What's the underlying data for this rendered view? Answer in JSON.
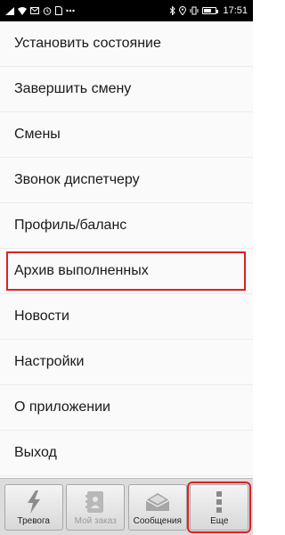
{
  "status_bar": {
    "time": "17:51",
    "battery_level": 0.7,
    "icons_left": [
      "signal-icon",
      "wifi-icon",
      "email-icon",
      "alarm-icon",
      "sim-icon",
      "more-icon"
    ],
    "icons_right": [
      "bluetooth-icon",
      "location-icon",
      "vibrate-icon",
      "battery-icon"
    ]
  },
  "menu": {
    "items": [
      {
        "label": "Установить состояние"
      },
      {
        "label": "Завершить смену"
      },
      {
        "label": "Смены"
      },
      {
        "label": "Звонок диспетчеру"
      },
      {
        "label": "Профиль/баланс"
      },
      {
        "label": "Архив выполненных"
      },
      {
        "label": "Новости"
      },
      {
        "label": "Настройки"
      },
      {
        "label": "О приложении"
      },
      {
        "label": "Выход"
      }
    ]
  },
  "bottom_bar": {
    "buttons": [
      {
        "label": "Тревога",
        "icon": "lightning-icon"
      },
      {
        "label": "Мой заказ",
        "icon": "contact-card-icon"
      },
      {
        "label": "Сообщения",
        "icon": "envelope-icon"
      },
      {
        "label": "Еще",
        "icon": "more-vertical-icon"
      }
    ]
  },
  "colors": {
    "highlight": "#e02020",
    "menu_bg": "#fafafa",
    "bottom_bar_bg": "#dcdcdc",
    "status_bar_bg": "#000000"
  }
}
